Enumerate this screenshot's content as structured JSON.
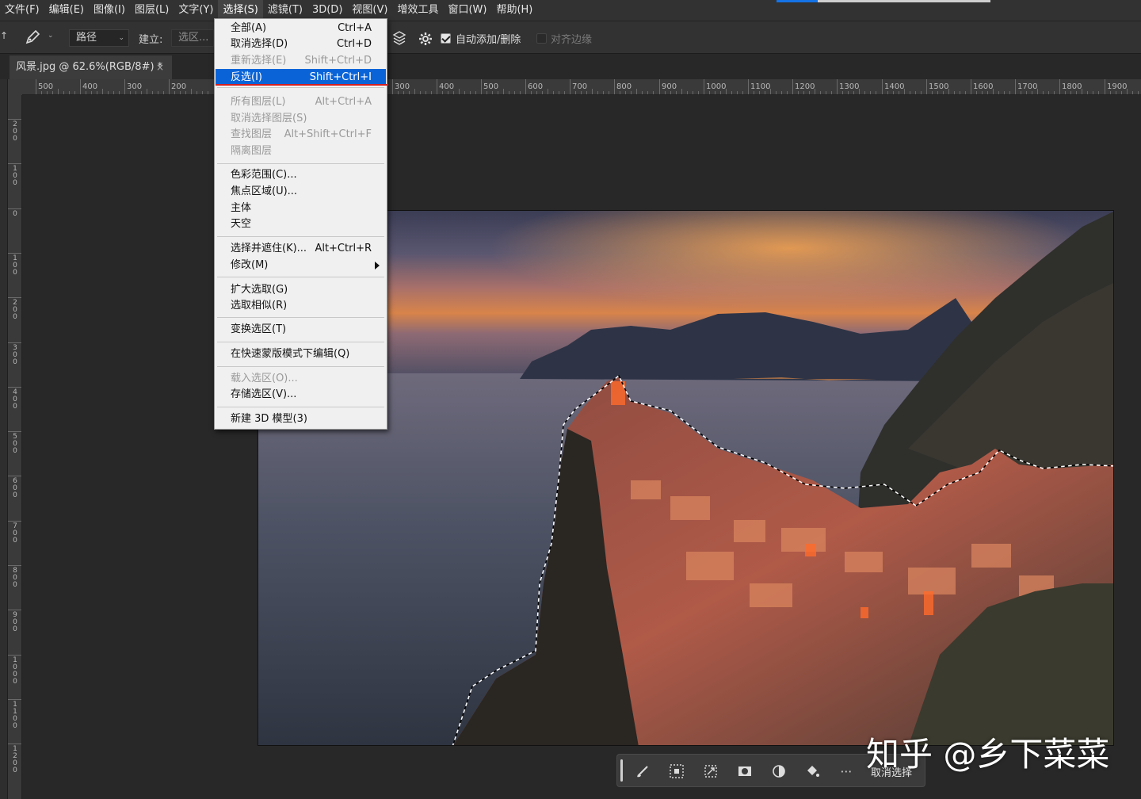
{
  "menubar": {
    "items": [
      {
        "label": "文件(F)"
      },
      {
        "label": "编辑(E)"
      },
      {
        "label": "图像(I)"
      },
      {
        "label": "图层(L)"
      },
      {
        "label": "文字(Y)"
      },
      {
        "label": "选择(S)",
        "active": true
      },
      {
        "label": "滤镜(T)"
      },
      {
        "label": "3D(D)"
      },
      {
        "label": "视图(V)"
      },
      {
        "label": "增效工具"
      },
      {
        "label": "窗口(W)"
      },
      {
        "label": "帮助(H)"
      }
    ]
  },
  "options": {
    "path_mode": "路径",
    "build_label": "建立:",
    "selection_btn": "选区...",
    "auto_add_label": "自动添加/删除",
    "auto_add_checked": true,
    "align_edges_label": "对齐边缘",
    "align_edges_checked": false
  },
  "document": {
    "tab_title": "风景.jpg @ 62.6%(RGB/8#) *",
    "close_glyph": "×"
  },
  "rulers": {
    "horizontal": [
      "500",
      "400",
      "300",
      "200",
      "300",
      "400",
      "500",
      "600",
      "700",
      "800",
      "900",
      "1000",
      "1100",
      "1200",
      "1300",
      "1400",
      "1500",
      "1600",
      "1700",
      "1800",
      "1900"
    ],
    "vertical": [
      "200",
      "100",
      "0",
      "100",
      "200",
      "300",
      "400",
      "500",
      "600",
      "700",
      "800",
      "900",
      "1000",
      "1100",
      "1200"
    ]
  },
  "select_menu": {
    "items": [
      {
        "label": "全部(A)",
        "shortcut": "Ctrl+A",
        "disabled": false
      },
      {
        "label": "取消选择(D)",
        "shortcut": "Ctrl+D",
        "disabled": false
      },
      {
        "label": "重新选择(E)",
        "shortcut": "Shift+Ctrl+D",
        "disabled": true
      },
      {
        "label": "反选(I)",
        "shortcut": "Shift+Ctrl+I",
        "disabled": false,
        "highlighted": true
      },
      {
        "label": "所有图层(L)",
        "shortcut": "Alt+Ctrl+A",
        "disabled": true
      },
      {
        "label": "取消选择图层(S)",
        "shortcut": "",
        "disabled": true
      },
      {
        "label": "查找图层",
        "shortcut": "Alt+Shift+Ctrl+F",
        "disabled": true
      },
      {
        "label": "隔离图层",
        "shortcut": "",
        "disabled": true
      },
      {
        "label": "色彩范围(C)...",
        "shortcut": "",
        "disabled": false
      },
      {
        "label": "焦点区域(U)...",
        "shortcut": "",
        "disabled": false
      },
      {
        "label": "主体",
        "shortcut": "",
        "disabled": false
      },
      {
        "label": "天空",
        "shortcut": "",
        "disabled": false
      },
      {
        "label": "选择并遮住(K)...",
        "shortcut": "Alt+Ctrl+R",
        "disabled": false
      },
      {
        "label": "修改(M)",
        "shortcut": "",
        "disabled": false,
        "submenu": true
      },
      {
        "label": "扩大选取(G)",
        "shortcut": "",
        "disabled": false
      },
      {
        "label": "选取相似(R)",
        "shortcut": "",
        "disabled": false
      },
      {
        "label": "变换选区(T)",
        "shortcut": "",
        "disabled": false
      },
      {
        "label": "在快速蒙版模式下编辑(Q)",
        "shortcut": "",
        "disabled": false
      },
      {
        "label": "载入选区(O)...",
        "shortcut": "",
        "disabled": true
      },
      {
        "label": "存储选区(V)...",
        "shortcut": "",
        "disabled": false
      },
      {
        "label": "新建 3D 模型(3)",
        "shortcut": "",
        "disabled": false
      }
    ]
  },
  "taskbar": {
    "deselect_label": "取消选择",
    "icons": [
      "brush-select-icon",
      "select-subject-icon",
      "transform-selection-icon",
      "mask-icon",
      "adjustment-icon",
      "fill-icon",
      "more-icon"
    ]
  },
  "watermark": "知乎 @乡下菜菜",
  "colors": {
    "accent": "#0a64d8",
    "menu_active_underline": "#d42020",
    "panel": "#323232",
    "canvas_bg": "#282828"
  }
}
